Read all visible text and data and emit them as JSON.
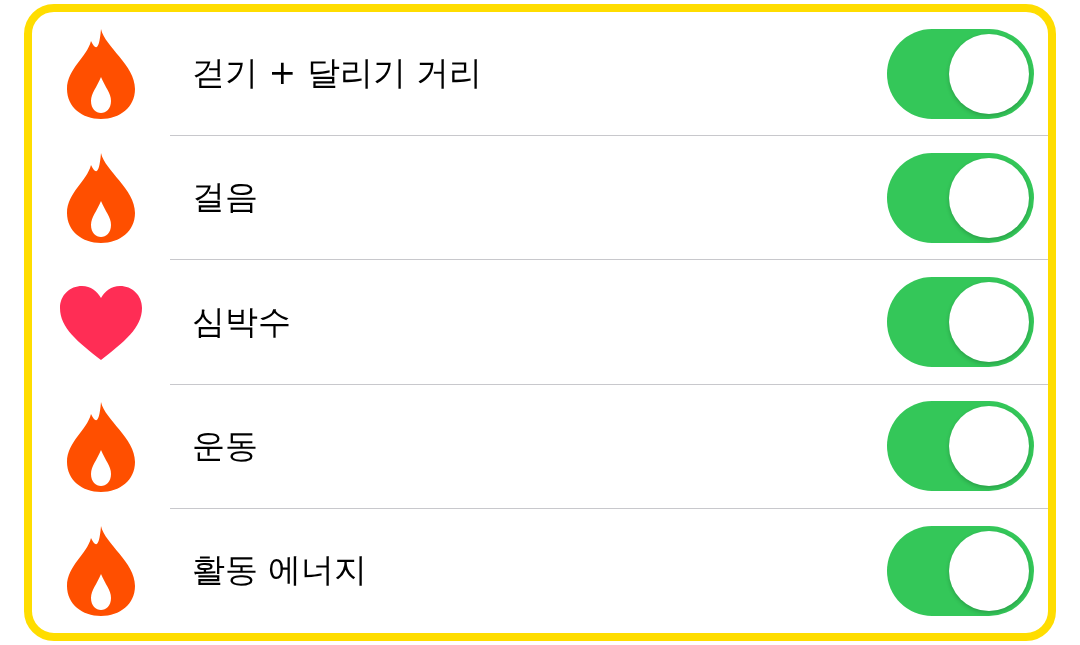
{
  "settings": [
    {
      "kind": "flame",
      "label": "걷기 + 달리기 거리",
      "on": true
    },
    {
      "kind": "flame",
      "label": "걸음",
      "on": true
    },
    {
      "kind": "heart",
      "label": "심박수",
      "on": true
    },
    {
      "kind": "flame",
      "label": "운동",
      "on": true
    },
    {
      "kind": "flame",
      "label": "활동 에너지",
      "on": true
    }
  ]
}
